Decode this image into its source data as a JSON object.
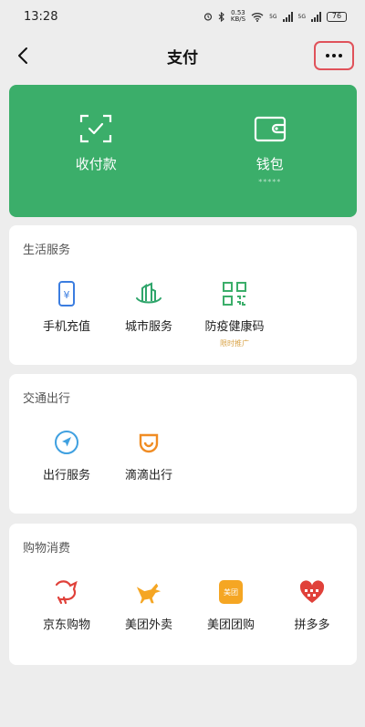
{
  "status_bar": {
    "time": "13:28",
    "speed_value": "0.53",
    "speed_unit": "KB/S",
    "signal_label_1": "5G",
    "signal_label_2": "5G",
    "battery": "76"
  },
  "header": {
    "title": "支付"
  },
  "hero": {
    "items": [
      {
        "label": "收付款",
        "icon": "scan-check-icon"
      },
      {
        "label": "钱包",
        "icon": "wallet-icon",
        "balance_mask": "*****"
      }
    ]
  },
  "sections": [
    {
      "title": "生活服务",
      "items": [
        {
          "label": "手机充值",
          "icon": "phone-recharge-icon",
          "color": "#3b7de0"
        },
        {
          "label": "城市服务",
          "icon": "city-service-icon",
          "color": "#2fa56b"
        },
        {
          "label": "防疫健康码",
          "icon": "health-code-icon",
          "color": "#3bae6a",
          "tag": "限时推广"
        }
      ]
    },
    {
      "title": "交通出行",
      "items": [
        {
          "label": "出行服务",
          "icon": "navigation-icon",
          "color": "#3fa0e0"
        },
        {
          "label": "滴滴出行",
          "icon": "didi-icon",
          "color": "#f08c23"
        }
      ]
    },
    {
      "title": "购物消费",
      "items": [
        {
          "label": "京东购物",
          "icon": "jd-dog-icon",
          "color": "#e0413a"
        },
        {
          "label": "美团外卖",
          "icon": "meituan-kangaroo-icon",
          "color": "#f5a623"
        },
        {
          "label": "美团团购",
          "icon": "meituan-icon",
          "color": "#f5a623",
          "badge": "美团"
        },
        {
          "label": "拼多多",
          "icon": "pinduoduo-icon",
          "color": "#e0413a"
        }
      ]
    }
  ]
}
